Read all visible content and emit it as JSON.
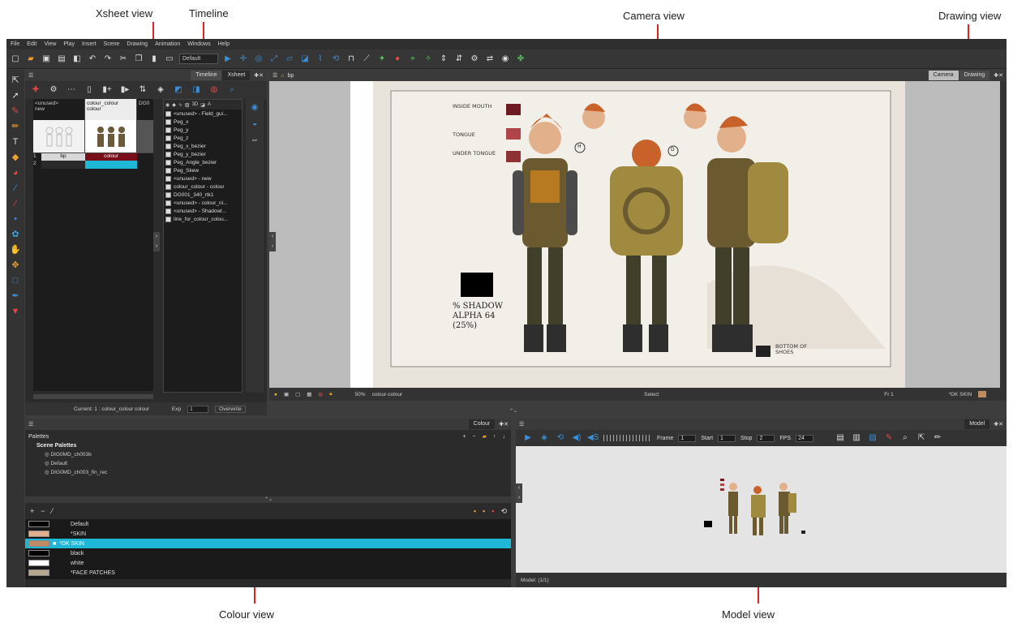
{
  "callouts": {
    "xsheet_view": "Xsheet view",
    "timeline": "Timeline",
    "camera_view": "Camera view",
    "drawing_view": "Drawing view",
    "colour_view": "Colour view",
    "model_view": "Model view"
  },
  "menu": [
    "File",
    "Edit",
    "View",
    "Play",
    "Insert",
    "Scene",
    "Drawing",
    "Animation",
    "Windows",
    "Help"
  ],
  "toolbar": {
    "preset_select": "Default"
  },
  "xsheet": {
    "tabs": [
      "Timeline",
      "Xsheet"
    ],
    "columns": [
      {
        "name": "<unused>",
        "sub": "new"
      },
      {
        "name": "colour_colour",
        "sub": "colour"
      },
      {
        "name": "DG0",
        "sub": ""
      }
    ],
    "cells": [
      {
        "frame": "1",
        "c1": "bp",
        "c2": "colour"
      },
      {
        "frame": "2",
        "c1": "",
        "c2": ""
      }
    ],
    "status": "Current: 1 : colour_colour colour",
    "exp_label": "Exp",
    "exp_value": "1",
    "overwrite": "Overwrite"
  },
  "layers": {
    "header_icons": [
      "3D",
      "A"
    ],
    "items": [
      "<unused> - Field_gui...",
      "Peg_x",
      "Peg_y",
      "Peg_z",
      "Peg_x_bezier",
      "Peg_y_bezier",
      "Peg_Angle_bezier",
      "Peg_Skew",
      "<unused> - new",
      "colour_colour - colour",
      "DG001_340_rtk1",
      "<unused> - colour_ni...",
      "<unused> - Shadowl...",
      "line_for_colour_colou..."
    ]
  },
  "camera": {
    "tabs": [
      "Camera",
      "Drawing"
    ],
    "crumb": "bp",
    "zoom": "50%",
    "drawing_name": "colour-colour",
    "tool": "Select",
    "frame": "Fr 1",
    "swatch_label": "*DK SKIN",
    "sheet": {
      "swatches": [
        {
          "label": "INSIDE MOUTH",
          "color": "#6e1a22"
        },
        {
          "label": "TONGUE",
          "color": "#b0444a"
        },
        {
          "label": "UNDER TONGUE",
          "color": "#8e3236"
        }
      ],
      "shadow_note": "% SHADOW ALPHA 64 (25%)",
      "bottom_note": "BOTTOM OF SHOES",
      "markers": [
        "H",
        "D"
      ]
    }
  },
  "colour": {
    "tab": "Colour",
    "palettes_label": "Palettes",
    "scene_palettes_label": "Scene Palettes",
    "palettes": [
      "DIG0MD_ch003b",
      "Default",
      "DIG0MD_ch003_fin_rec"
    ],
    "swatches": [
      {
        "name": "Default",
        "color": "#000000"
      },
      {
        "name": "*SKIN",
        "color": "#e2b08a"
      },
      {
        "name": "*DK SKIN",
        "color": "#c08a62"
      },
      {
        "name": "black",
        "color": "#000000"
      },
      {
        "name": "white",
        "color": "#ffffff"
      },
      {
        "name": "*FACE PATCHES",
        "color": "#b8a890"
      }
    ],
    "selected_index": 2
  },
  "model": {
    "tab": "Model",
    "frame_label": "Frame",
    "frame_value": "1",
    "start_label": "Start",
    "start_value": "1",
    "stop_label": "Stop",
    "stop_value": "2",
    "fps_label": "FPS",
    "fps_value": "24",
    "status": "Model: (1/1)"
  },
  "colors": {
    "accent_select": "#1fb7d6",
    "bg_dark": "#2b2b2b",
    "skin": "#e2b08a",
    "dk_skin": "#c08a62"
  }
}
